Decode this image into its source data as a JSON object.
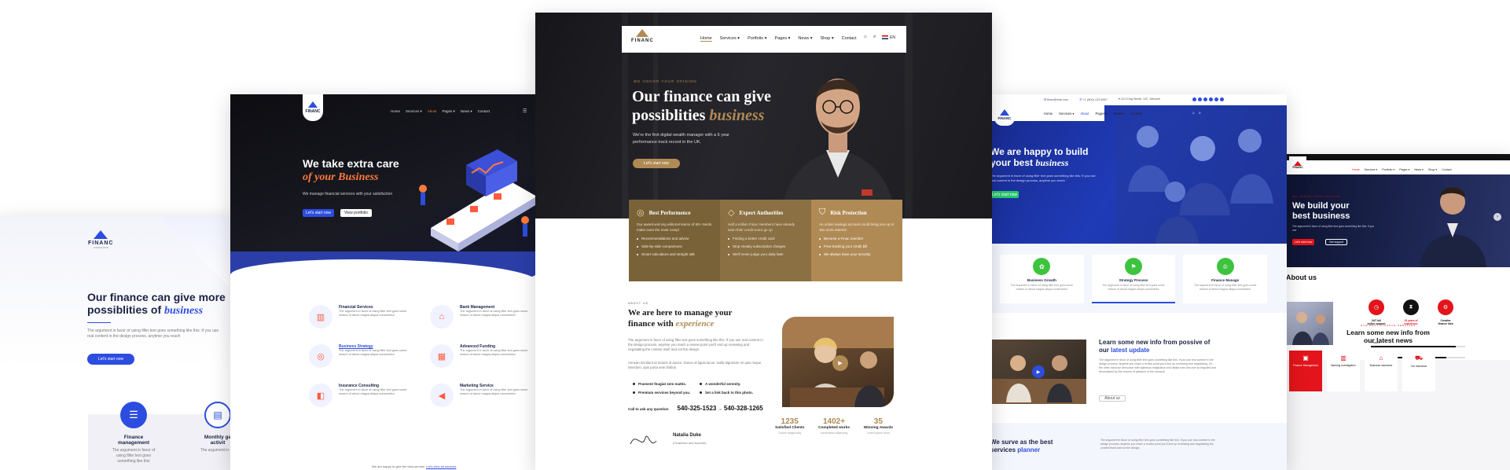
{
  "colors": {
    "blue": "#2c4de0",
    "gold": "#b08a55",
    "dark": "#1e1e22",
    "red": "#e3141b",
    "navy": "#1a2244"
  },
  "panelA": {
    "logo": "FINANC",
    "logo_sub": "CONSULTING",
    "headline1": "Our finance can give more",
    "headline2": "possiblities of",
    "headline_em": "business",
    "body": "The argument in favor of using filler text goes something like this: If you use real content in the design process, anytime you reach",
    "cta": "Let's start now",
    "cards": [
      {
        "icon": "finance-management-icon",
        "label1": "Finance",
        "label2": "management",
        "text": "The argument in favor of using filler text goes something like this"
      },
      {
        "icon": "monthly-activity-icon",
        "label1": "Monthly ge",
        "label2": "activit",
        "text": "The argument in fav"
      }
    ]
  },
  "panelB": {
    "logo": "FINANC",
    "nav": [
      "Home",
      "Services ▾",
      "About",
      "Pages ▾",
      "News ▾",
      "Contact"
    ],
    "headline": "We take extra care",
    "headline_em": "of your Business",
    "sub": "We manage financial services with your satisfaction",
    "btn_primary": "Let's start now",
    "btn_secondary": "View portfolio",
    "services": [
      {
        "icon": "financial-services-icon",
        "title": "Financial Services",
        "text": "The argument in favor of using filler text goes some reason of about magna aliqua consectetur"
      },
      {
        "icon": "bank-management-icon",
        "title": "Bank Management",
        "text": "The argument in favor of using filler text goes some reason of about magna aliqua consectetur"
      },
      {
        "icon": "business-strategy-icon",
        "title": "Business Strategy",
        "text": "The argument in favor of using filler text goes some reason of about magna aliqua consectetur"
      },
      {
        "icon": "advanced-funding-icon",
        "title": "Advanced Funding",
        "text": "The argument in favor of using filler text goes some reason of about magna aliqua consectetur"
      },
      {
        "icon": "insurance-consulting-icon",
        "title": "Insurance Consulting",
        "text": "The argument in favor of using filler text goes some reason of about magna aliqua consectetur"
      },
      {
        "icon": "marketing-service-icon",
        "title": "Marketing Service",
        "text": "The argument in favor of using filler text goes some reason of about magna aliqua consectetur"
      }
    ],
    "footer_note": "We are happy to give the best service.",
    "footer_link": "Let's view all services"
  },
  "panelC": {
    "logo": "FINANC",
    "nav": [
      "Home",
      "Services ▾",
      "Portfolio ▾",
      "Pages ▾",
      "News ▾",
      "Shop ▾",
      "Contact"
    ],
    "lang": "EN",
    "eyebrow": "WE HONOR YOUR OPINION",
    "headline1": "Our finance can give",
    "headline2": "possiblities",
    "headline_em": "business",
    "sub": "We're the first digital wealth manager with a 6 year performance track record in the UK.",
    "cta": "Let's start now",
    "features": [
      {
        "icon": "target-icon",
        "title": "Best Performence",
        "text": "Our award-winning editorial teams of 80+ Nerds make even the most compl",
        "items": [
          "Recommendations and advice",
          "Side-by-side comparisons",
          "Smart calculators and straight talk"
        ]
      },
      {
        "icon": "diamond-icon",
        "title": "Expert Authorities",
        "text": "Half a million Finac members have already seen their credit score go up",
        "items": [
          "Finding a better credit card",
          "Stop sneaky subscription charges",
          "We'll never judge your daily latte"
        ]
      },
      {
        "icon": "shield-check-icon",
        "title": "Risk Protection",
        "text": "An online savings account could bring you up to 15x more interest",
        "items": [
          "Become a Finac member",
          "Free tracking your credit bill",
          "We always have your security"
        ]
      }
    ],
    "about_eyebrow": "ABOUT US",
    "about_title1": "We are here to manage your",
    "about_title2": "finance with",
    "about_em": "experience",
    "about_p1": "The argument in favor of using filler text goes something like this: If you use real content in the design process, anytime you reach a review point you'll end up reviewing and negotiating the content itself and not the design.",
    "about_p2": "Aenean tincidunt id mauris id auctor. Donec at ligula lacus. Nulla dignissim mi quis neque interdum, quis porta sem finibus.",
    "checks": [
      "Praesent feugiat sem mattis.",
      "A wonderful serenity.",
      "Premium services beyond you.",
      "Set a link back to this photo."
    ],
    "call_label": "Call to ask any question",
    "phone1": "540-325-1523",
    "phone_or": "or",
    "phone2": "540-328-1265",
    "signer_name": "Natalia Duke",
    "signer_role": "(Chairman and founder)",
    "stats": [
      {
        "value": "1235",
        "label": "Satisfied Clients",
        "sub": "Dolore magna aliq"
      },
      {
        "value": "1402+",
        "label": "Completed works",
        "sub": "consectetur adipiscing"
      },
      {
        "value": "35",
        "label": "Winning Awards",
        "sub": "Lorem ipsum dolor"
      }
    ]
  },
  "panelD": {
    "topbar": [
      "finac@mail.com",
      "+1 (800) 123 4567",
      "121 King Street, VIC, Menzeh"
    ],
    "logo": "FINANC",
    "nav": [
      "Home",
      "Services ▾",
      "About",
      "Pages ▾",
      "News ▾",
      "Contact"
    ],
    "headline1": "We are happy to build",
    "headline2": "your best",
    "headline_em": "business",
    "sub": "The argument in favor of using filler text goes something like this: If you use real content in the design process, anytime you reach",
    "cta": "Let's start now",
    "features": [
      {
        "icon": "plant-growth-icon",
        "title": "Business Growth",
        "text": "The argument in favor of using filler text goes some reason of about magna aliqua consectetur"
      },
      {
        "icon": "strategy-icon",
        "title": "Strategy Process",
        "text": "The argument in favor of using filler text goes some reason of about magna aliqua consectetur"
      },
      {
        "icon": "finance-manage-icon",
        "title": "Finance Manage",
        "text": "The argument in favor of using filler text goes some reason of about magna aliqua consectetur"
      }
    ],
    "update_title1": "Learn some new info from possive of",
    "update_title2": "our",
    "update_em": "latest update",
    "update_text": "The argument in favor of using filler text goes something like this: If you use real content in the design process, anytime you reach a review point you'll end up reviewing and negotiating. On the other hand we denounce with righteous indignation and dislike men who are so beguiled and demoralized by the charms of pleasure of the moment",
    "update_btn": "About us",
    "serve_title1": "We surve as the best",
    "serve_title2": "services",
    "serve_em": "planner",
    "serve_text": "The argument in favor of using filler text goes something like this: If you use real content in the design process, anytime you reach a review point you'll end up reviewing and negotiating the content itself and not the design."
  },
  "panelE": {
    "logo": "FINANC",
    "nav": [
      "Home",
      "Services ▾",
      "Portfolio ▾",
      "Pages ▾",
      "News ▾",
      "Shop ▾",
      "Contact"
    ],
    "eyebrow": "WE HONOR YOUR OPINION",
    "headline1": "We build your",
    "headline2": "best business",
    "sub": "The argument in favor of using filler text goes something like this: If you use",
    "btn_primary": "Let's start now",
    "btn_secondary": "Get support",
    "about_title": "About us",
    "circles": [
      {
        "icon": "clock-icon",
        "label1": "24/7 full",
        "label2": "online support"
      },
      {
        "icon": "hourglass-icon",
        "label1": "15 years of",
        "label2": "experience"
      },
      {
        "icon": "gear-icon",
        "label1": "Creative",
        "label2": "finance idea"
      }
    ],
    "bars": [
      {
        "label": "Finance",
        "value": 90
      },
      {
        "label": "Business",
        "value": 80
      },
      {
        "label": "Investment",
        "value": 70
      }
    ],
    "eyebrow2": "OUR BEST FINANCE SERVICES",
    "info_title1": "Learn some new info from",
    "info_title2": "our latest news",
    "tiles": [
      {
        "icon": "finance-management-tile-icon",
        "label": "Finance Management",
        "active": true
      },
      {
        "icon": "banking-investigation-icon",
        "label": "Banking Investigation",
        "active": false
      },
      {
        "icon": "business-insurance-icon",
        "label": "Business Insurance",
        "active": false
      },
      {
        "icon": "car-insurance-icon",
        "label": "Car Insurance",
        "active": false
      }
    ]
  }
}
